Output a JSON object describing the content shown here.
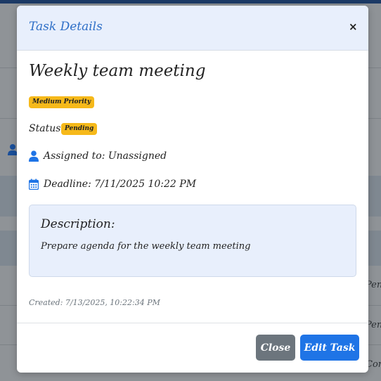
{
  "background": {
    "peek_texts": [
      "Pendi",
      "Pendi",
      "Comp"
    ]
  },
  "modal": {
    "title": "Task Details",
    "close_symbol": "×",
    "task_title": "Weekly team meeting",
    "priority_badge": "Medium Priority",
    "status_label": "Status:",
    "status_value": "Pending",
    "assigned_text": "Assigned to: Unassigned",
    "deadline_text": "Deadline: 7/11/2025 10:22 PM",
    "description": {
      "heading": "Description:",
      "text": "Prepare agenda for the weekly team meeting"
    },
    "created_text": "Created: 7/13/2025, 10:22:34 PM",
    "buttons": {
      "close": "Close",
      "edit": "Edit Task"
    },
    "icons": {
      "assigned": "person-icon",
      "deadline": "calendar-icon"
    },
    "colors": {
      "accent": "#1f74e6",
      "title": "#2f6fc7",
      "badge": "#f6b91a",
      "header_bg": "#e8effc",
      "secondary_button": "#6c757d"
    }
  }
}
